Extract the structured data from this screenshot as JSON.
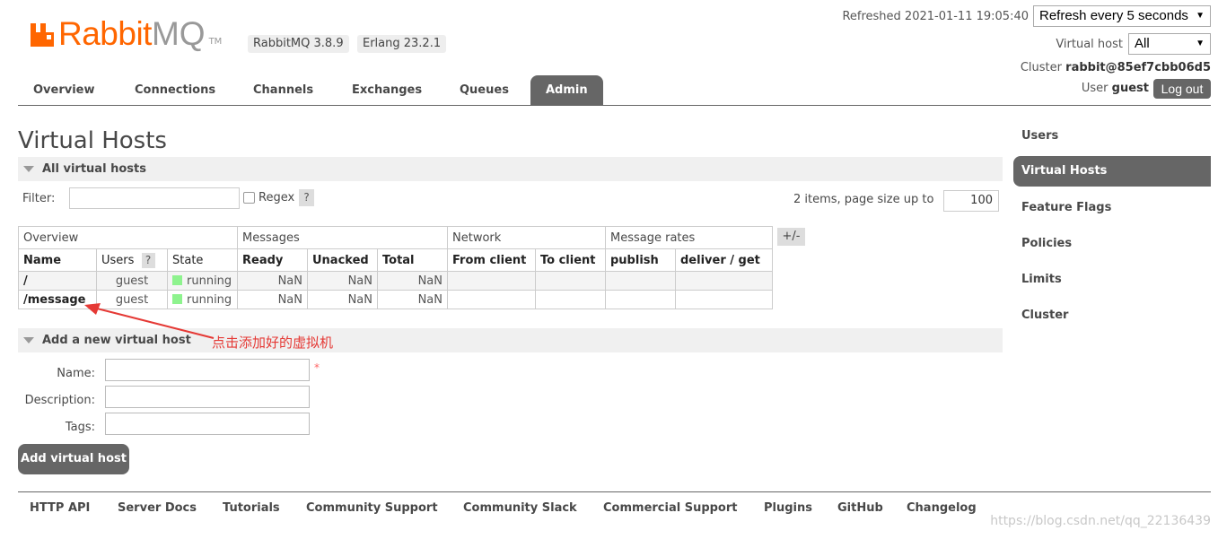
{
  "header": {
    "logo_rabbit": "Rabbit",
    "logo_mq": "MQ",
    "logo_tm": "TM",
    "rabbitmq_version": "RabbitMQ 3.8.9",
    "erlang_version": "Erlang 23.2.1",
    "refreshed": "Refreshed 2021-01-11 19:05:40",
    "refresh_select": "Refresh every 5 seconds",
    "vhost_label": "Virtual host",
    "vhost_select": "All",
    "cluster_label": "Cluster",
    "cluster_name": "rabbit@85ef7cbb06d5",
    "user_label": "User",
    "user_name": "guest",
    "logout_label": "Log out",
    "logo_color": "#ff6600"
  },
  "tabs": [
    "Overview",
    "Connections",
    "Channels",
    "Exchanges",
    "Queues",
    "Admin"
  ],
  "active_tab": "Admin",
  "right_nav": [
    "Users",
    "Virtual Hosts",
    "Feature Flags",
    "Policies",
    "Limits",
    "Cluster"
  ],
  "page_title": "Virtual Hosts",
  "all_vhosts": {
    "section_title": "All virtual hosts",
    "filter_label": "Filter:",
    "regex_label": "Regex",
    "help": "?",
    "pager_text": "2 items, page size up to",
    "page_size": "100",
    "plus_minus": "+/-",
    "group_headers": [
      "Overview",
      "Messages",
      "Network",
      "Message rates"
    ],
    "columns": [
      "Name",
      "Users",
      "State",
      "Ready",
      "Unacked",
      "Total",
      "From client",
      "To client",
      "publish",
      "deliver / get"
    ],
    "rows": [
      {
        "name": "/",
        "users": "guest",
        "state": "running",
        "ready": "NaN",
        "unacked": "NaN",
        "total": "NaN"
      },
      {
        "name": "/message",
        "users": "guest",
        "state": "running",
        "ready": "NaN",
        "unacked": "NaN",
        "total": "NaN"
      }
    ]
  },
  "annotation": "点击添加好的虚拟机",
  "add_vhost": {
    "section_title": "Add a new virtual host",
    "name_label": "Name:",
    "description_label": "Description:",
    "tags_label": "Tags:",
    "required": "*",
    "button_label": "Add virtual host"
  },
  "footer": [
    "HTTP API",
    "Server Docs",
    "Tutorials",
    "Community Support",
    "Community Slack",
    "Commercial Support",
    "Plugins",
    "GitHub",
    "Changelog"
  ],
  "watermark": "https://blog.csdn.net/qq_22136439"
}
